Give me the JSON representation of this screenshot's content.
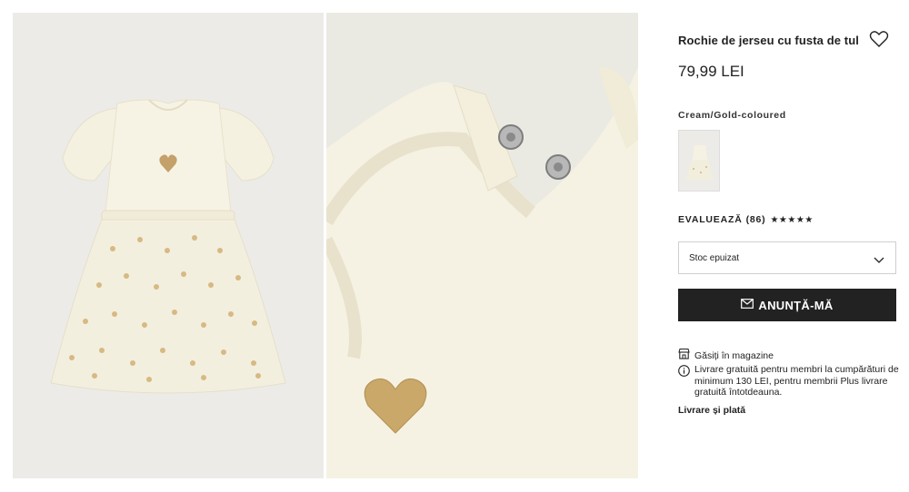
{
  "product": {
    "title": "Rochie de jerseu cu fusta de tul",
    "price": "79,99 LEI",
    "color_name": "Cream/Gold-coloured",
    "images": [
      {
        "alt": "dress-front-view"
      },
      {
        "alt": "dress-detail-view"
      }
    ]
  },
  "rating": {
    "label": "EVALUEAZĂ",
    "count": "(86)",
    "stars": "★★★★★",
    "value": 5
  },
  "size_select": {
    "value": "Stoc epuizat"
  },
  "cta": {
    "label": "ANUNȚĂ-MĂ",
    "icon": "envelope-icon"
  },
  "store": {
    "label": "Găsiți în magazine",
    "icon": "store-icon"
  },
  "shipping": {
    "text": "Livrare gratuită pentru membri la cumpărături de minimum 130 LEI, pentru membrii Plus livrare gratuită întotdeauna.",
    "icon": "info-icon"
  },
  "delivery_link": "Livrare și plată",
  "colors": {
    "cta_bg": "#222222",
    "dress_cream": "#f4f0df",
    "gold": "#c9a86a"
  }
}
